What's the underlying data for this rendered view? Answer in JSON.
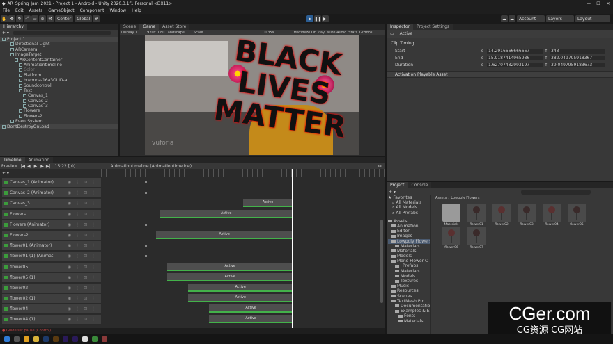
{
  "title": "AR_Spring_Jam_2021 - Project 1 - Android - Unity 2020.3.1f1 Personal <DX11>",
  "menu": [
    "File",
    "Edit",
    "Assets",
    "GameObject",
    "Component",
    "Window",
    "Help"
  ],
  "toolbar": {
    "center": "Center",
    "global": "Global",
    "account": "Account",
    "layers": "Layers",
    "layout": "Layout"
  },
  "hierarchy": {
    "tab": "Hierarchy",
    "items": [
      {
        "label": "Project 1",
        "indent": 0,
        "style": "normal"
      },
      {
        "label": "Directional Light",
        "indent": 2,
        "style": "normal"
      },
      {
        "label": "ARCamera",
        "indent": 2,
        "style": "normal"
      },
      {
        "label": "ImageTarget",
        "indent": 2,
        "style": "normal"
      },
      {
        "label": "ARContentContainer",
        "indent": 3,
        "style": "normal"
      },
      {
        "label": "Animationtimeline",
        "indent": 4,
        "style": "normal"
      },
      {
        "label": "Color",
        "indent": 4,
        "style": "dim"
      },
      {
        "label": "Platform",
        "indent": 4,
        "style": "normal"
      },
      {
        "label": "breonna-16a3OLID-a",
        "indent": 4,
        "style": "normal"
      },
      {
        "label": "Soundcontrol",
        "indent": 4,
        "style": "normal"
      },
      {
        "label": "Text",
        "indent": 4,
        "style": "normal"
      },
      {
        "label": "Canvas_1",
        "indent": 5,
        "style": "normal"
      },
      {
        "label": "Canvas_2",
        "indent": 5,
        "style": "normal"
      },
      {
        "label": "Canvas_3",
        "indent": 5,
        "style": "normal"
      },
      {
        "label": "Flowers",
        "indent": 4,
        "style": "normal"
      },
      {
        "label": "Flowers2",
        "indent": 4,
        "style": "normal"
      },
      {
        "label": "EventSystem",
        "indent": 2,
        "style": "normal"
      },
      {
        "label": "DontDestroyOnLoad",
        "indent": 0,
        "style": "normal"
      }
    ]
  },
  "scene": {
    "tabs": [
      "Scene",
      "Game",
      "Asset Store"
    ],
    "display": "Display 1",
    "resolution": "1920x1080 Landscape",
    "scale_label": "Scale",
    "scale": "0.35x",
    "options": [
      "Maximize On Play",
      "Mute Audio",
      "Stats",
      "Gizmos"
    ],
    "overlay_text": [
      "BLACK",
      "LIVES",
      "MATTER"
    ],
    "watermark": "vuforia"
  },
  "inspector": {
    "tabs": [
      "Inspector",
      "Project Settings"
    ],
    "object": "Active",
    "section": "Clip Timing",
    "fields": [
      {
        "label": "Start",
        "s": "14.2916666666667",
        "f": "343"
      },
      {
        "label": "End",
        "s": "15.9187414965986",
        "f": "382.049795918367"
      },
      {
        "label": "Duration",
        "s": "1.62707482993197",
        "f": "39.0497959183673"
      }
    ],
    "section2": "Activation Playable Asset"
  },
  "timeline": {
    "tabs": [
      "Timeline",
      "Animation"
    ],
    "preview": "Preview",
    "frame": "15:22 [.0]",
    "asset": "Animationtimeline (Animationtimeline)",
    "tracks": [
      {
        "label": "Canvas_1 (Animator)",
        "clip": null
      },
      {
        "label": "Canvas_2 (Animator)",
        "clip": null
      },
      {
        "label": "Canvas_3",
        "clip": {
          "text": "Active",
          "start": 0.74,
          "end": 1.0
        }
      },
      {
        "label": "Flowers",
        "clip": {
          "text": "Active",
          "start": 0.3,
          "end": 1.0
        }
      },
      {
        "label": "Flowers (Animator)",
        "clip": null
      },
      {
        "label": "Flowers2",
        "clip": {
          "text": "Active",
          "start": 0.28,
          "end": 1.0
        }
      },
      {
        "label": "flower01 (Animator)",
        "clip": null
      },
      {
        "label": "flower01 (1) (Animat",
        "clip": null
      },
      {
        "label": "flower05",
        "clip": {
          "text": "Active",
          "start": 0.34,
          "end": 1.0
        }
      },
      {
        "label": "flower05 (1)",
        "clip": {
          "text": "Active",
          "start": 0.34,
          "end": 1.0
        }
      },
      {
        "label": "flower02",
        "clip": {
          "text": "Active",
          "start": 0.45,
          "end": 1.0
        }
      },
      {
        "label": "flower02 (1)",
        "clip": {
          "text": "Active",
          "start": 0.45,
          "end": 1.0
        }
      },
      {
        "label": "flower04",
        "clip": {
          "text": "Active",
          "start": 0.56,
          "end": 1.0
        }
      },
      {
        "label": "flower04 (1)",
        "clip": {
          "text": "Active",
          "start": 0.56,
          "end": 1.0
        }
      }
    ],
    "status": "Guide set pause (Control)"
  },
  "project": {
    "tabs": [
      "Project",
      "Console"
    ],
    "favorites": [
      "Favorites",
      "All Materials",
      "All Models",
      "All Prefabs"
    ],
    "tree": [
      {
        "label": "Assets",
        "indent": 0
      },
      {
        "label": "Animation",
        "indent": 1
      },
      {
        "label": "Editor",
        "indent": 1
      },
      {
        "label": "Images",
        "indent": 1
      },
      {
        "label": "Lowpoly Flowers",
        "indent": 1
      },
      {
        "label": "Materials",
        "indent": 2
      },
      {
        "label": "Materials",
        "indent": 1
      },
      {
        "label": "Models",
        "indent": 1
      },
      {
        "label": "Mono Flower C",
        "indent": 1
      },
      {
        "label": "_Prefabs",
        "indent": 2
      },
      {
        "label": "Materials",
        "indent": 2
      },
      {
        "label": "Models",
        "indent": 2
      },
      {
        "label": "Textures",
        "indent": 2
      },
      {
        "label": "Music",
        "indent": 1
      },
      {
        "label": "Resources",
        "indent": 1
      },
      {
        "label": "Scenes",
        "indent": 1
      },
      {
        "label": "TextMesh Pro",
        "indent": 1
      },
      {
        "label": "Documentation",
        "indent": 2
      },
      {
        "label": "Examples & Ex",
        "indent": 2
      },
      {
        "label": "Fonts",
        "indent": 3
      },
      {
        "label": "Materials",
        "indent": 3
      }
    ],
    "breadcrumb": [
      "Assets",
      "Lowpoly Flowers"
    ],
    "assets": [
      "Materials",
      "flower01",
      "flower02",
      "flower03",
      "flower04",
      "flower05",
      "flower06",
      "flower07"
    ]
  },
  "watermark": {
    "big": "CGer.com",
    "small": "CG资源 CG网站"
  }
}
